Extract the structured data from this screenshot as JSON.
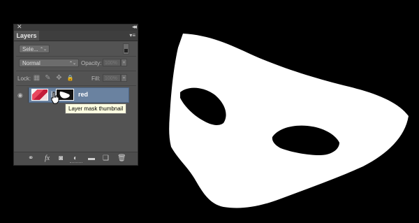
{
  "panel": {
    "close_glyph": "✕",
    "collapse_glyph": "◂◂",
    "tab_label": "Layers",
    "menu_glyph": "▾≡",
    "filter_label": "Sele...",
    "blend_mode": "Normal",
    "opacity_label": "Opacity:",
    "opacity_value": "100%",
    "lock_label": "Lock:",
    "fill_label": "Fill:",
    "fill_value": "100%",
    "dropdown_glyph": "▾",
    "stepper_glyph": "⌃⌄"
  },
  "layer": {
    "name": "red",
    "eye_glyph": "◉",
    "link_glyph": "⛓"
  },
  "tooltip": "Layer mask thumbnail",
  "icons": {
    "lock_transparency": "▦",
    "lock_paint": "✎",
    "lock_move": "✥",
    "lock_all": "🔒",
    "link_layers": "⚭",
    "fx": "fx",
    "add_mask": "◙",
    "adjustment": "◐",
    "group": "▬",
    "new_layer": "❑",
    "delete": "🗑"
  },
  "colors": {
    "canvas_bg": "#000000",
    "panel_bg": "#535353",
    "selection": "#6a82a0",
    "tooltip_bg": "#ffffe1",
    "mask_white": "#ffffff"
  }
}
